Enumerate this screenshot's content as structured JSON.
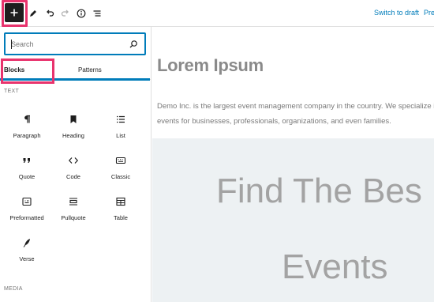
{
  "toolbar": {
    "add_icon": "plus-icon",
    "tools_icon": "pencil-icon",
    "undo_icon": "undo-icon",
    "redo_icon": "redo-icon",
    "details_icon": "info-icon",
    "outline_icon": "list-view-icon",
    "switch_to_draft": "Switch to draft",
    "preview": "Pre"
  },
  "inserter": {
    "search_placeholder": "Search",
    "tabs": {
      "blocks": "Blocks",
      "patterns": "Patterns"
    },
    "categories": {
      "text": "TEXT",
      "media": "MEDIA"
    },
    "blocks": [
      {
        "label": "Paragraph",
        "icon": "paragraph-icon"
      },
      {
        "label": "Heading",
        "icon": "heading-bookmark-icon"
      },
      {
        "label": "List",
        "icon": "list-icon"
      },
      {
        "label": "Quote",
        "icon": "quote-icon"
      },
      {
        "label": "Code",
        "icon": "code-icon"
      },
      {
        "label": "Classic",
        "icon": "keyboard-icon"
      },
      {
        "label": "Preformatted",
        "icon": "preformatted-icon"
      },
      {
        "label": "Pullquote",
        "icon": "pullquote-icon"
      },
      {
        "label": "Table",
        "icon": "table-icon"
      },
      {
        "label": "Verse",
        "icon": "verse-quill-icon"
      }
    ]
  },
  "editor": {
    "title": "Lorem Ipsum",
    "paragraph_line1": "Demo Inc. is the largest event management company in the country. We specialize in or",
    "paragraph_line2": "events for businesses, professionals, organizations, and even families.",
    "cover_line1": "Find The Bes",
    "cover_line2": "Events"
  },
  "colors": {
    "accent": "#007cba",
    "highlight": "#e8336d",
    "dark": "#1e1e1e"
  }
}
